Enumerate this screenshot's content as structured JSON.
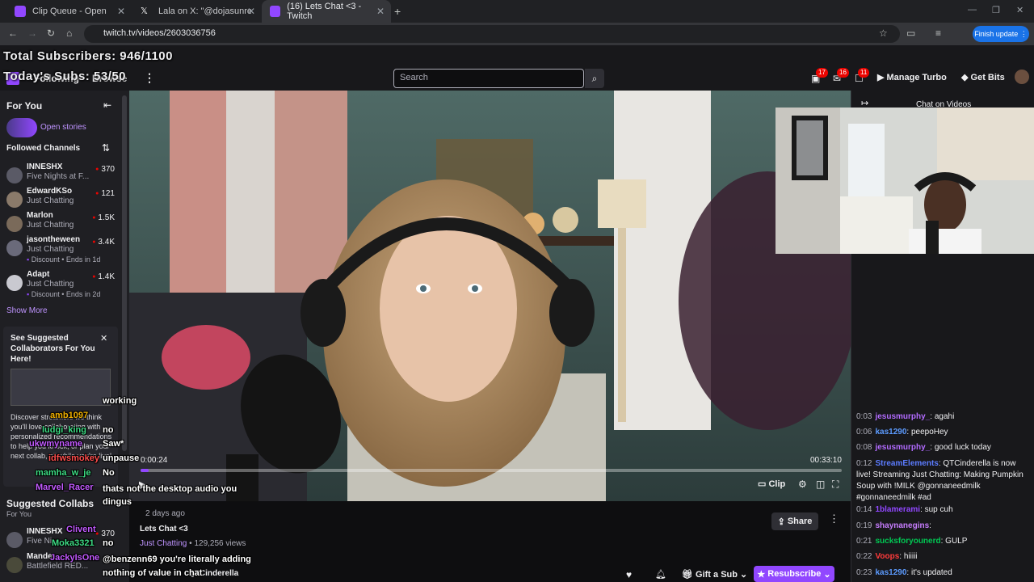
{
  "browser": {
    "tabs": [
      {
        "title": "Clip Queue - Open"
      },
      {
        "title": "Lala on X: \"@dojasunreleased u"
      },
      {
        "title": "(16) Lets Chat <3 - Twitch"
      }
    ],
    "url": "twitch.tv/videos/2603036756",
    "finish_update": "Finish update"
  },
  "overlay": {
    "total_subs": "Total Subscribers: 946/1100",
    "todays_subs": "Today's Subs: 53/50"
  },
  "topnav": {
    "following": "Following",
    "browse": "Browse",
    "search_placeholder": "Search",
    "badges": [
      "17",
      "16",
      "11"
    ],
    "manage_turbo": "Manage Turbo",
    "get_bits": "Get Bits"
  },
  "sidebar": {
    "for_you": "For You",
    "open_stories": "Open stories",
    "followed_channels": "Followed Channels",
    "channels": [
      {
        "name": "INNESHX",
        "game": "Five Nights at F...",
        "viewers": "370",
        "extra": ""
      },
      {
        "name": "EdwardKSo",
        "game": "Just Chatting",
        "viewers": "121",
        "extra": ""
      },
      {
        "name": "Marlon",
        "game": "Just Chatting",
        "viewers": "1.5K",
        "extra": ""
      },
      {
        "name": "jasontheween",
        "game": "Just Chatting",
        "viewers": "3.4K",
        "extra": "Discount • Ends in 1d"
      },
      {
        "name": "Adapt",
        "game": "Just Chatting",
        "viewers": "1.4K",
        "extra": "Discount • Ends in 2d"
      }
    ],
    "show_more": "Show More",
    "suggest_title": "See Suggested Collaborators For You Here!",
    "suggest_body": "Discover streamers we think you'll love collaborating with — personalized recommendations to help you knock, or plan your next collab, all while you're live!",
    "suggested_collabs": "Suggested Collabs",
    "for_you_sub": "For You",
    "collab_channels": [
      {
        "name": "INNESHX",
        "game": "Five Ni...",
        "viewers": "370"
      },
      {
        "name": "Mande",
        "game": "Battlefield RED...",
        "viewers": ""
      }
    ]
  },
  "video": {
    "time_current": "0:00:24",
    "time_total": "00:33:10",
    "progress": 0.012,
    "clip": "Clip",
    "posted": "2 days ago",
    "title": "Lets Chat <3",
    "category": "Just Chatting",
    "views": "129,256 views",
    "share": "Share",
    "gift_sub": "Gift a Sub",
    "resubscribe": "Resubscribe",
    "channel": "QTCinderella"
  },
  "chat": {
    "header": "Chat on Videos",
    "messages": [
      {
        "time": "0:03",
        "user": "jesusmurphy_",
        "color": "#b26bff",
        "text": "agahi"
      },
      {
        "time": "0:06",
        "user": "kas1290",
        "color": "#5c9bff",
        "text": "peepoHey"
      },
      {
        "time": "0:08",
        "user": "jesusmurphy_",
        "color": "#b26bff",
        "text": "good luck today"
      },
      {
        "time": "0:12",
        "user": "StreamElements",
        "color": "#5c7cff",
        "text": "QTCinderella is now live! Streaming Just Chatting: Making Pumpkin Soup with !MILK @gonnaneedmilk #gonnaneedmilk #ad"
      },
      {
        "time": "0:14",
        "user": "1blamerami",
        "color": "#9147ff",
        "text": "sup cuh"
      },
      {
        "time": "0:19",
        "user": "shaynanegins",
        "color": "#c77dff",
        "text": ""
      },
      {
        "time": "0:21",
        "user": "sucksforyounerd",
        "color": "#00c853",
        "text": "GULP"
      },
      {
        "time": "0:22",
        "user": "Voops",
        "color": "#ff3b3b",
        "text": "hiiiii"
      },
      {
        "time": "0:23",
        "user": "kas1290",
        "color": "#5c9bff",
        "text": "it's updated"
      }
    ]
  },
  "overlay_chat": [
    {
      "user": "",
      "text": "working",
      "color": "#ffffff"
    },
    {
      "user": "amb1097",
      "text": "",
      "color": "#f0b000"
    },
    {
      "user": "ludgi_king",
      "text": "no",
      "color": "#3ddc84"
    },
    {
      "user": "ukwmyname",
      "text": "Saw*",
      "color": "#c25aff"
    },
    {
      "user": "idfwsmokey",
      "text": "unpause",
      "color": "#ff4d4d"
    },
    {
      "user": "mamha_w_je",
      "text": "No",
      "color": "#3ddc84"
    },
    {
      "user": "Marvel_Racer",
      "text": "thats not the desktop audio you dingus",
      "color": "#c25aff"
    },
    {
      "user": "Clivent",
      "text": "no",
      "color": "#c25aff"
    },
    {
      "user": "Moka3321",
      "text": "",
      "color": "#3ddc84"
    },
    {
      "user": "JackyIsOne",
      "text": "@benzenn69 you're literally adding nothing of value in chat",
      "color": "#c25aff"
    }
  ]
}
